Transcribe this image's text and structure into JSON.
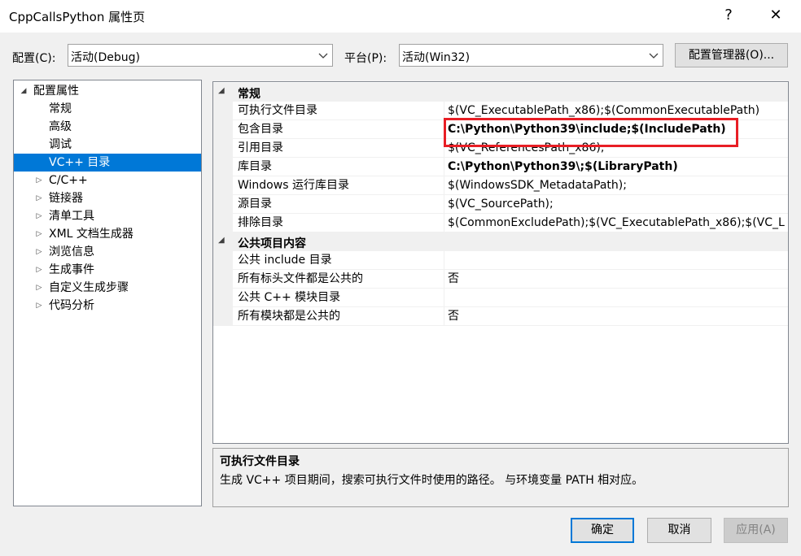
{
  "window": {
    "title": "CppCallsPython 属性页",
    "help": "?",
    "close": "✕"
  },
  "config": {
    "label": "配置(C):",
    "value": "活动(Debug)",
    "platform_label": "平台(P):",
    "platform_value": "活动(Win32)",
    "manager_button": "配置管理器(O)..."
  },
  "tree": {
    "items": [
      {
        "label": "配置属性",
        "expander": "◢"
      },
      {
        "label": "常规"
      },
      {
        "label": "高级"
      },
      {
        "label": "调试"
      },
      {
        "label": "VC++ 目录"
      },
      {
        "label": "C/C++",
        "expander": "▷"
      },
      {
        "label": "链接器",
        "expander": "▷"
      },
      {
        "label": "清单工具",
        "expander": "▷"
      },
      {
        "label": "XML 文档生成器",
        "expander": "▷"
      },
      {
        "label": "浏览信息",
        "expander": "▷"
      },
      {
        "label": "生成事件",
        "expander": "▷"
      },
      {
        "label": "自定义生成步骤",
        "expander": "▷"
      },
      {
        "label": "代码分析",
        "expander": "▷"
      }
    ]
  },
  "grid": {
    "categories": [
      {
        "name": "常规",
        "expander": "◢",
        "rows": [
          {
            "name": "可执行文件目录",
            "value": "$(VC_ExecutablePath_x86);$(CommonExecutablePath)",
            "bold": false
          },
          {
            "name": "包含目录",
            "value": "C:\\Python\\Python39\\include;$(IncludePath)",
            "bold": true
          },
          {
            "name": "引用目录",
            "value": "$(VC_ReferencesPath_x86);",
            "bold": false
          },
          {
            "name": "库目录",
            "value": "C:\\Python\\Python39\\;$(LibraryPath)",
            "bold": true
          },
          {
            "name": "Windows 运行库目录",
            "value": "$(WindowsSDK_MetadataPath);",
            "bold": false
          },
          {
            "name": "源目录",
            "value": "$(VC_SourcePath);",
            "bold": false
          },
          {
            "name": "排除目录",
            "value": "$(CommonExcludePath);$(VC_ExecutablePath_x86);$(VC_L",
            "bold": false
          }
        ]
      },
      {
        "name": "公共项目内容",
        "expander": "◢",
        "rows": [
          {
            "name": "公共 include 目录",
            "value": "",
            "bold": false
          },
          {
            "name": "所有标头文件都是公共的",
            "value": "否",
            "bold": false
          },
          {
            "name": "公共 C++ 模块目录",
            "value": "",
            "bold": false
          },
          {
            "name": "所有模块都是公共的",
            "value": "否",
            "bold": false
          }
        ]
      }
    ]
  },
  "description": {
    "title": "可执行文件目录",
    "text": "生成 VC++ 项目期间，搜索可执行文件时使用的路径。 与环境变量 PATH 相对应。"
  },
  "buttons": {
    "ok": "确定",
    "cancel": "取消",
    "apply": "应用(A)"
  },
  "colors": {
    "selection": "#0078d7",
    "highlight_box": "#e81e25"
  }
}
